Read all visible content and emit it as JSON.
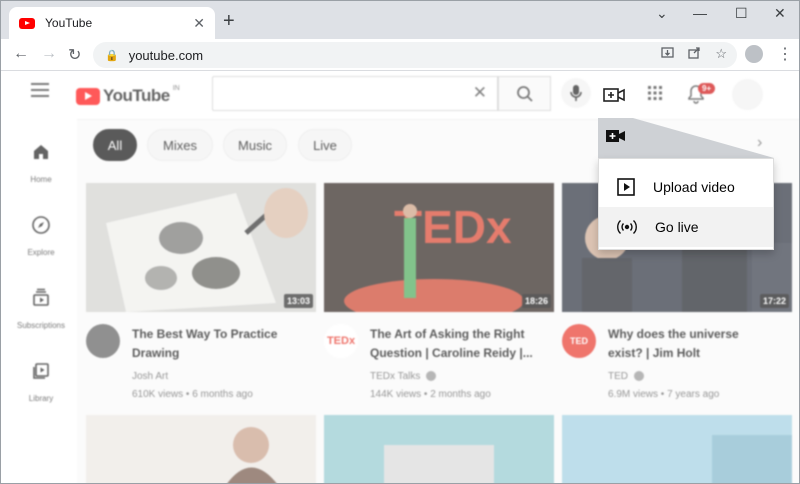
{
  "browser": {
    "tab_title": "YouTube",
    "url": "youtube.com",
    "window_controls": [
      "minimize-icon",
      "maximize-icon",
      "close-icon"
    ]
  },
  "youtube": {
    "logo_text": "YouTube",
    "country_code": "IN",
    "search_value": "",
    "notification_badge": "9+",
    "sidebar": [
      {
        "label": "Home",
        "icon": "home-icon"
      },
      {
        "label": "Explore",
        "icon": "compass-icon"
      },
      {
        "label": "Subscriptions",
        "icon": "subscriptions-icon"
      },
      {
        "label": "Library",
        "icon": "library-icon"
      }
    ],
    "chips": [
      "All",
      "Mixes",
      "Music",
      "Live"
    ],
    "active_chip": "All",
    "videos": [
      {
        "title_line1": "The Best Way To Practice",
        "title_line2": "Drawing",
        "channel": "Josh Art",
        "meta": "610K views • 6 months ago",
        "duration": "13:03"
      },
      {
        "title_line1": "The Art of Asking the Right",
        "title_line2": "Question | Caroline Reidy |...",
        "channel": "TEDx Talks",
        "meta": "144K views • 2 months ago",
        "duration": "18:26"
      },
      {
        "title_line1": "Why does the universe",
        "title_line2": "exist? | Jim Holt",
        "channel": "TED",
        "meta": "6.9M views • 7 years ago",
        "duration": "17:22"
      }
    ],
    "tedx_stage_text": "TEDx",
    "create_menu": {
      "items": [
        {
          "label": "Upload video",
          "icon": "play-square-icon"
        },
        {
          "label": "Go live",
          "icon": "broadcast-icon"
        }
      ],
      "hovered_item": "Go live"
    }
  },
  "colors": {
    "brand_red": "#ff0000",
    "badge_red": "#cc0000",
    "chip_active": "#030303"
  }
}
